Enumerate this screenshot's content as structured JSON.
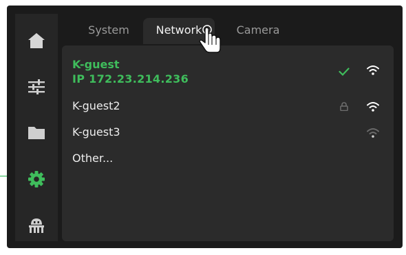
{
  "sidebar": {
    "items": [
      {
        "icon": "home-icon",
        "active": false
      },
      {
        "icon": "sliders-icon",
        "active": false
      },
      {
        "icon": "folder-icon",
        "active": false
      },
      {
        "icon": "gear-icon",
        "active": true
      },
      {
        "icon": "robot-icon",
        "active": false
      }
    ]
  },
  "tabs": [
    {
      "label": "System",
      "active": false
    },
    {
      "label": "Network",
      "active": true
    },
    {
      "label": "Camera",
      "active": false
    }
  ],
  "networks": [
    {
      "name": "K-guest",
      "ip": "IP  172.23.214.236",
      "status": "connected",
      "status_icon": "checkmark-icon",
      "signal": "strong"
    },
    {
      "name": "K-guest2",
      "status": "locked",
      "status_icon": "lock-icon",
      "signal": "strong"
    },
    {
      "name": "K-guest3",
      "status": "open",
      "signal": "weak"
    }
  ],
  "other_option": "Other...",
  "colors": {
    "accent_green": "#3fbd5c",
    "background": "#1b1b1b",
    "sidebar": "#262626",
    "panel": "#2b2b2b"
  }
}
